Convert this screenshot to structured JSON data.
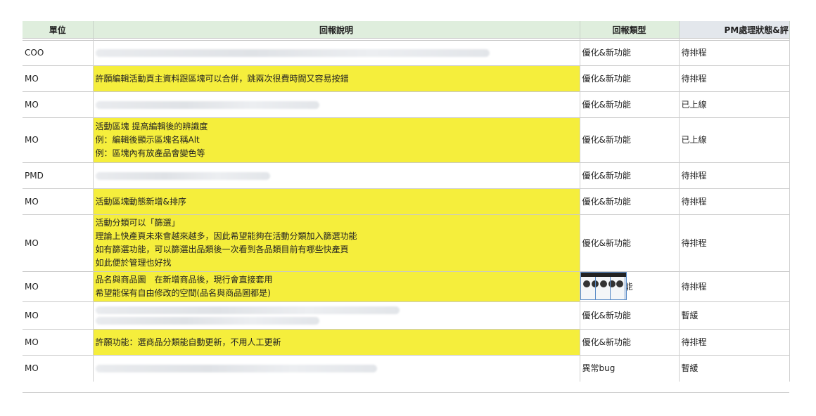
{
  "headers": {
    "unit": "單位",
    "desc": "回報說明",
    "type": "回報類型",
    "status": "PM處理狀態&評"
  },
  "rows": [
    {
      "unit": "COO",
      "desc": [],
      "blurred": [
        560
      ],
      "yellow": false,
      "type": "優化&新功能",
      "status": "待排程"
    },
    {
      "unit": "MO",
      "desc": [
        "許願編輯活動頁主資料跟區塊可以合併，跳兩次很費時間又容易按錯"
      ],
      "yellow": true,
      "type": "優化&新功能",
      "status": "待排程"
    },
    {
      "unit": "MO",
      "desc": [],
      "blurred": [
        318
      ],
      "yellow": false,
      "type": "優化&新功能",
      "status": "已上線"
    },
    {
      "unit": "MO",
      "desc": [
        "活動區塊 提高編輯後的辨識度",
        "例：編輯後顯示區塊名稱Alt",
        "例：區塊內有放產品會變色等"
      ],
      "yellow": true,
      "type": "優化&新功能",
      "status": "已上線"
    },
    {
      "unit": "PMD",
      "desc": [],
      "blurred": [
        248
      ],
      "yellow": false,
      "type": "優化&新功能",
      "status": "待排程"
    },
    {
      "unit": "MO",
      "desc": [
        "活動區塊動態新增&排序"
      ],
      "yellow": true,
      "type": "優化&新功能",
      "status": "待排程"
    },
    {
      "unit": "MO",
      "desc": [
        "活動分類可以「篩選」",
        "理論上快產頁未來會越來越多，因此希望能夠在活動分類加入篩選功能",
        "如有篩選功能，可以篩選出品類後一次看到各品類目前有哪些快產頁",
        "如此便於管理也好找"
      ],
      "yellow": true,
      "type": "優化&新功能",
      "status": "待排程"
    },
    {
      "unit": "MO",
      "desc": [
        "品名與商品圖　在新增商品後，現行會直接套用",
        "希望能保有自由修改的空間(品名與商品圖都是)"
      ],
      "yellow": true,
      "type": "能",
      "status": "待排程",
      "thumb": true
    },
    {
      "unit": "MO",
      "desc": [],
      "blurred": [
        432,
        318
      ],
      "yellow": false,
      "type": "優化&新功能",
      "status": "暫緩"
    },
    {
      "unit": "MO",
      "desc": [
        "許願功能：選商品分類能自動更新，不用人工更新"
      ],
      "yellow": true,
      "type": "優化&新功能",
      "status": "待排程"
    },
    {
      "unit": "MO",
      "desc": [],
      "blurred": [
        400
      ],
      "yellow": false,
      "type": "異常bug",
      "status": "暫緩"
    }
  ]
}
